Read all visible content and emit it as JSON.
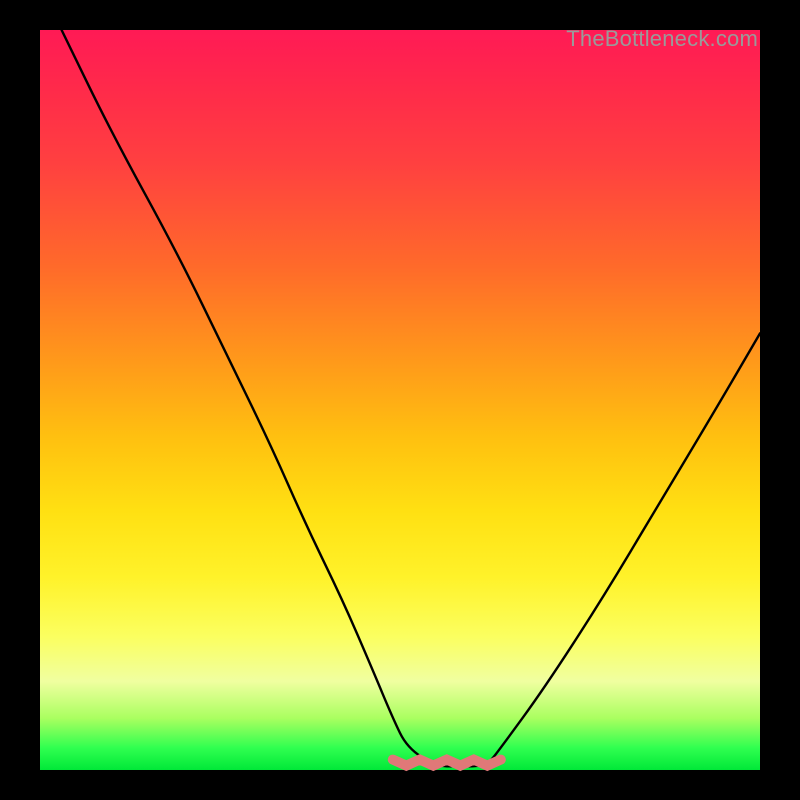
{
  "watermark": "TheBottleneck.com",
  "colors": {
    "background_frame": "#000000",
    "gradient_top": "#ff1a55",
    "gradient_bottom": "#00e838",
    "curve_stroke": "#000000",
    "bottom_accent": "#e07878"
  },
  "chart_data": {
    "type": "line",
    "title": "",
    "xlabel": "",
    "ylabel": "",
    "xlim": [
      0,
      100
    ],
    "ylim": [
      0,
      100
    ],
    "series": [
      {
        "name": "bottleneck-curve",
        "x": [
          3,
          10,
          19,
          26,
          32,
          37,
          42,
          46,
          49,
          51,
          55,
          58,
          62,
          64,
          70,
          78,
          86,
          94,
          100
        ],
        "y": [
          100,
          86,
          70,
          56,
          44,
          33,
          23,
          14,
          7,
          3,
          0.5,
          0.5,
          0.5,
          3,
          11,
          23,
          36,
          49,
          59
        ]
      }
    ],
    "annotations": [
      {
        "name": "flat-bottom-accent",
        "x_range": [
          49,
          64
        ],
        "y": 1,
        "color": "#e07878"
      }
    ]
  }
}
